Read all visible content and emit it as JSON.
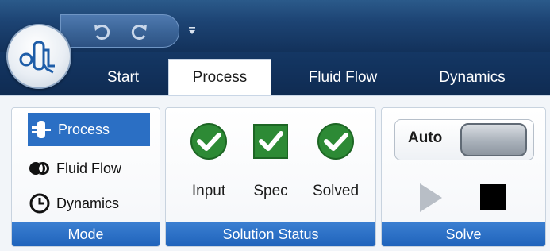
{
  "tabs": [
    {
      "label": "Start"
    },
    {
      "label": "Process"
    },
    {
      "label": "Fluid Flow"
    },
    {
      "label": "Dynamics"
    }
  ],
  "ribbon": {
    "mode": {
      "label": "Mode",
      "items": [
        {
          "label": "Process",
          "icon": "process-icon",
          "active": true
        },
        {
          "label": "Fluid Flow",
          "icon": "fluid-flow-icon",
          "active": false
        },
        {
          "label": "Dynamics",
          "icon": "clock-icon",
          "active": false
        }
      ]
    },
    "solution_status": {
      "label": "Solution Status",
      "items": [
        {
          "label": "Input",
          "icon": "check-circle-icon"
        },
        {
          "label": "Spec",
          "icon": "check-square-icon"
        },
        {
          "label": "Solved",
          "icon": "check-circle-icon"
        }
      ]
    },
    "solve": {
      "label": "Solve",
      "auto_label": "Auto",
      "play_icon": "play-icon",
      "stop_icon": "stop-icon"
    }
  },
  "colors": {
    "titlebar": "#1d4474",
    "group_label": "#1f63bb",
    "active_mode": "#2b6fc4",
    "status_ok": "#2d8a35"
  }
}
